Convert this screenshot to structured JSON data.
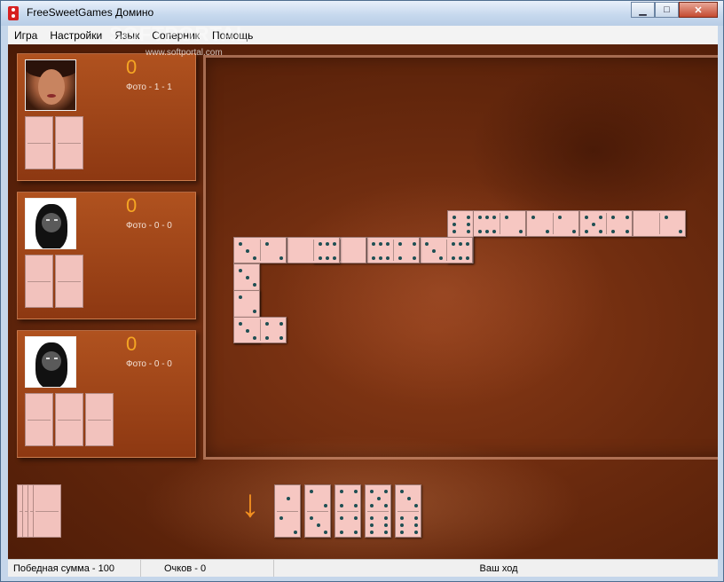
{
  "window": {
    "title": "FreeSweetGames Домино",
    "min_label": "▁",
    "max_label": "□",
    "close_label": "✕"
  },
  "menu": [
    "Игра",
    "Настройки",
    "Язык",
    "Соперник",
    "Помощь"
  ],
  "watermark": {
    "logo": "SOFTPORTAL",
    "url": "www.softportal.com"
  },
  "players": [
    {
      "score": "0",
      "photo_label": "Фото - 1 - 1",
      "avatar": "woman-avatar",
      "hand_count": 2
    },
    {
      "score": "0",
      "photo_label": "Фото - 0 - 0",
      "avatar": "man-avatar",
      "hand_count": 2
    },
    {
      "score": "0",
      "photo_label": "Фото - 0 - 0",
      "avatar": "man-avatar",
      "hand_count": 3
    }
  ],
  "board": [
    {
      "a": 6,
      "b": 6,
      "orient": "v"
    },
    {
      "a": 6,
      "b": 2,
      "orient": "h"
    },
    {
      "a": 2,
      "b": 2,
      "orient": "h"
    },
    {
      "a": 5,
      "b": 4,
      "orient": "h"
    },
    {
      "a": 0,
      "b": 2,
      "orient": "h"
    },
    {
      "a": 3,
      "b": 6,
      "orient": "h"
    },
    {
      "a": 6,
      "b": 4,
      "orient": "h"
    },
    {
      "a": 4,
      "b": 0,
      "orient": "h"
    },
    {
      "a": 0,
      "b": 6,
      "orient": "h"
    },
    {
      "a": 3,
      "b": 2,
      "orient": "h"
    },
    {
      "a": 3,
      "b": 3,
      "orient": "v"
    },
    {
      "a": 2,
      "b": 2,
      "orient": "v"
    },
    {
      "a": 3,
      "b": 4,
      "orient": "h"
    }
  ],
  "player_hand": [
    {
      "a": 1,
      "b": 2,
      "orient": "v"
    },
    {
      "a": 2,
      "b": 3,
      "orient": "v"
    },
    {
      "a": 4,
      "b": 4,
      "orient": "v"
    },
    {
      "a": 5,
      "b": 6,
      "orient": "v"
    },
    {
      "a": 3,
      "b": 6,
      "orient": "v"
    }
  ],
  "boneyard_count": 4,
  "turn_arrow": "↓",
  "status": {
    "target": "Победная сумма - 100",
    "points": "Очков - 0",
    "message": "Ваш ход"
  },
  "colors": {
    "score": "#f5a623",
    "tile": "#f6c7c2",
    "pip": "#1e4f53",
    "arrow": "#f39020"
  }
}
